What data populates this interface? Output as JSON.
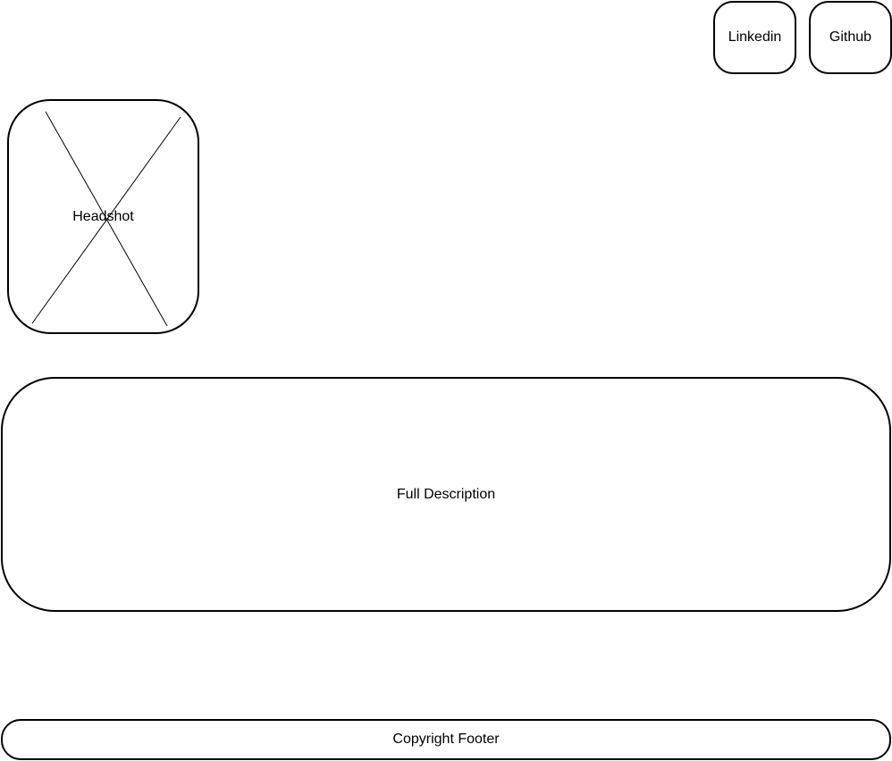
{
  "header": {
    "links": [
      {
        "label": "Linkedin"
      },
      {
        "label": "Github"
      }
    ]
  },
  "headshot": {
    "label": "Headshot",
    "icon": "image-placeholder-icon"
  },
  "description": {
    "label": "Full Description"
  },
  "footer": {
    "label": "Copyright Footer"
  }
}
